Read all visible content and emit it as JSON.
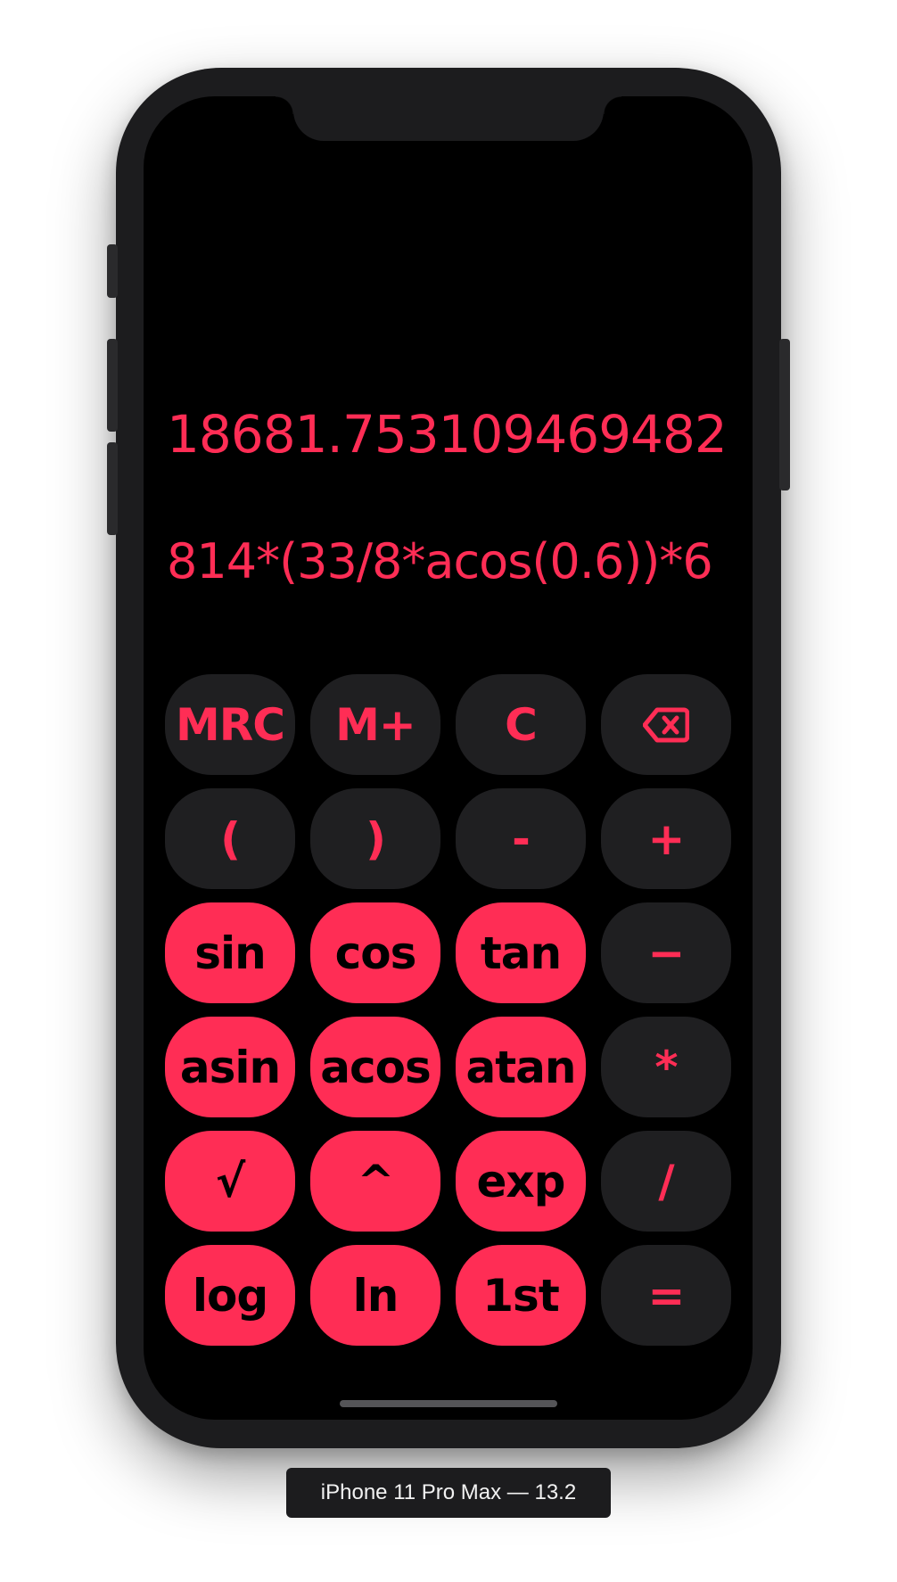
{
  "device_label": "iPhone 11 Pro Max — 13.2",
  "display": {
    "result": "18681.753109469482",
    "expression": "814*(33/8*acos(0.6))*6"
  },
  "colors": {
    "accent": "#ff2d55",
    "key_dark": "#1f1f21",
    "screen": "#000000",
    "bezel": "#1c1c1e"
  },
  "keys": [
    {
      "label": "MRC",
      "style": "dark"
    },
    {
      "label": "M+",
      "style": "dark"
    },
    {
      "label": "C",
      "style": "dark"
    },
    {
      "label": "",
      "style": "dark",
      "icon": "backspace-icon"
    },
    {
      "label": "(",
      "style": "dark"
    },
    {
      "label": ")",
      "style": "dark"
    },
    {
      "label": "-",
      "style": "dark"
    },
    {
      "label": "+",
      "style": "dark"
    },
    {
      "label": "sin",
      "style": "red"
    },
    {
      "label": "cos",
      "style": "red"
    },
    {
      "label": "tan",
      "style": "red"
    },
    {
      "label": "−",
      "style": "dark"
    },
    {
      "label": "asin",
      "style": "red"
    },
    {
      "label": "acos",
      "style": "red"
    },
    {
      "label": "atan",
      "style": "red"
    },
    {
      "label": "*",
      "style": "dark"
    },
    {
      "label": "√",
      "style": "red"
    },
    {
      "label": "^",
      "style": "red"
    },
    {
      "label": "exp",
      "style": "red"
    },
    {
      "label": "/",
      "style": "dark"
    },
    {
      "label": "log",
      "style": "red"
    },
    {
      "label": "ln",
      "style": "red"
    },
    {
      "label": "1st",
      "style": "red"
    },
    {
      "label": "=",
      "style": "dark"
    }
  ]
}
